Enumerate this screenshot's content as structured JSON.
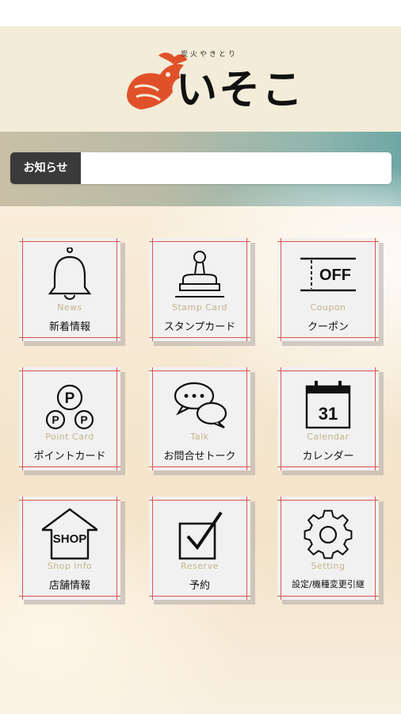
{
  "header": {
    "logo_tagline": "炭火やきとり",
    "logo_name": "いそこ"
  },
  "news": {
    "label": "お知らせ",
    "text": ""
  },
  "menu": [
    {
      "en": "News",
      "ja": "新着情報",
      "icon": "bell-icon"
    },
    {
      "en": "Stamp Card",
      "ja": "スタンプカード",
      "icon": "stamp-icon"
    },
    {
      "en": "Coupon",
      "ja": "クーポン",
      "icon": "coupon-icon",
      "icon_text": "OFF"
    },
    {
      "en": "Point Card",
      "ja": "ポイントカード",
      "icon": "point-coins-icon",
      "icon_text": "P"
    },
    {
      "en": "Talk",
      "ja": "お問合せトーク",
      "icon": "chat-bubbles-icon"
    },
    {
      "en": "Calendar",
      "ja": "カレンダー",
      "icon": "calendar-icon",
      "icon_text": "31"
    },
    {
      "en": "Shop Info",
      "ja": "店舗情報",
      "icon": "shop-icon",
      "icon_text": "SHOP"
    },
    {
      "en": "Reserve",
      "ja": "予約",
      "icon": "checkbox-icon"
    },
    {
      "en": "Setting",
      "ja": "設定/機種変更引継",
      "icon": "gear-icon"
    }
  ],
  "colors": {
    "tile_border": "#d9574a",
    "tile_label_en": "#c2b48a",
    "news_label_bg": "#3a3a3a",
    "logo_bird": "#e0512a"
  }
}
